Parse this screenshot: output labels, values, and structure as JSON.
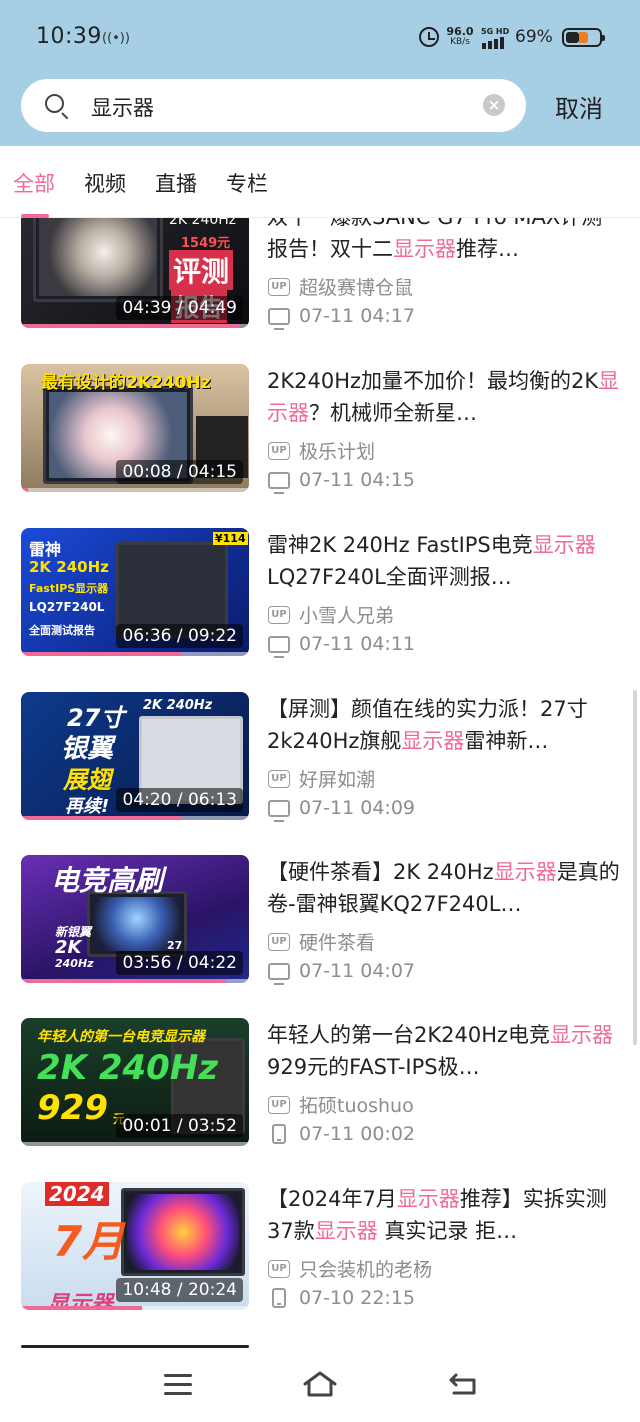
{
  "status_bar": {
    "time": "10:39",
    "hotspot_glyph": "((•))",
    "speed_value": "96.0",
    "speed_unit": "KB/s",
    "network": "5G HD",
    "battery_percent": "69%",
    "battery_level": 0.69
  },
  "search": {
    "query": "显示器",
    "clear_glyph": "×",
    "cancel_label": "取消"
  },
  "tabs": [
    {
      "label": "全部",
      "active": true
    },
    {
      "label": "视频",
      "active": false
    },
    {
      "label": "直播",
      "active": false
    },
    {
      "label": "专栏",
      "active": false
    }
  ],
  "videos": [
    {
      "title_parts": [
        "双十一爆款SANC G7 Pro MAX评测报告！双十二",
        "显示器",
        "推荐…"
      ],
      "uploader": "超级赛博仓鼠",
      "date": "07-11 04:17",
      "device": "tv",
      "duration": "04:39 / 04:49",
      "progress": 0.96,
      "thumb_texts": [
        "2K 240Hz",
        "1549元",
        "评测",
        "报告"
      ]
    },
    {
      "title_parts": [
        "2K240Hz加量不加价！最均衡的2K",
        "显示器",
        "？机械师全新星…"
      ],
      "uploader": "极乐计划",
      "date": "07-11 04:15",
      "device": "tv",
      "duration": "00:08 / 04:15",
      "progress": 0.03,
      "thumb_texts": [
        "最有设计的2K240Hz"
      ]
    },
    {
      "title_parts": [
        "雷神2K 240Hz FastIPS电竞",
        "显示器",
        "LQ27F240L全面评测报…"
      ],
      "uploader": "小雪人兄弟",
      "date": "07-11 04:11",
      "device": "tv",
      "duration": "06:36 / 09:22",
      "progress": 0.7,
      "thumb_texts": [
        "雷神",
        "2K 240Hz",
        "FastIPS显示器",
        "LQ27F240L",
        "全面测试报告",
        "¥114"
      ]
    },
    {
      "title_parts": [
        "【屏测】颜值在线的实力派！27寸2k240Hz旗舰",
        "显示器",
        "雷神新…"
      ],
      "uploader": "好屏如潮",
      "date": "07-11 04:09",
      "device": "tv",
      "duration": "04:20 / 06:13",
      "progress": 0.7,
      "thumb_texts": [
        "27寸",
        "银翼",
        "展翅",
        "再续!",
        "2K 240Hz"
      ]
    },
    {
      "title_parts": [
        "【硬件茶看】2K 240Hz",
        "显示器",
        "是真的卷-雷神银翼KQ27F240L…"
      ],
      "uploader": "硬件茶看",
      "date": "07-11 04:07",
      "device": "tv",
      "duration": "03:56 / 04:22",
      "progress": 0.9,
      "thumb_texts": [
        "电竞高刷",
        "新银翼",
        "2K",
        "240Hz",
        "27"
      ]
    },
    {
      "title_parts": [
        "年轻人的第一台2K240Hz电竞",
        "显示器",
        "929元的FAST-IPS极…"
      ],
      "uploader": "拓硕tuoshuo",
      "date": "07-11 00:02",
      "device": "phone",
      "duration": "00:01 / 03:52",
      "progress": 0.0,
      "thumb_texts": [
        "年轻人的第一台电竞显示器",
        "2K 240Hz",
        "929",
        "元"
      ]
    },
    {
      "title_parts": [
        "【2024年7月",
        "显示器",
        "推荐】实拆实测37款",
        "显示器",
        " 真实记录 拒…"
      ],
      "uploader": "只会装机的老杨",
      "date": "07-10 22:15",
      "device": "phone",
      "duration": "10:48 / 20:24",
      "progress": 0.53,
      "thumb_texts": [
        "2024",
        "7月",
        "显示器"
      ]
    }
  ],
  "nav_bar": {
    "icons": [
      "menu-icon",
      "home-icon",
      "back-icon"
    ]
  },
  "colors": {
    "header_bg": "#a6cfe5",
    "accent_pink": "#f06a97",
    "meta_gray": "#8d8d8d"
  }
}
